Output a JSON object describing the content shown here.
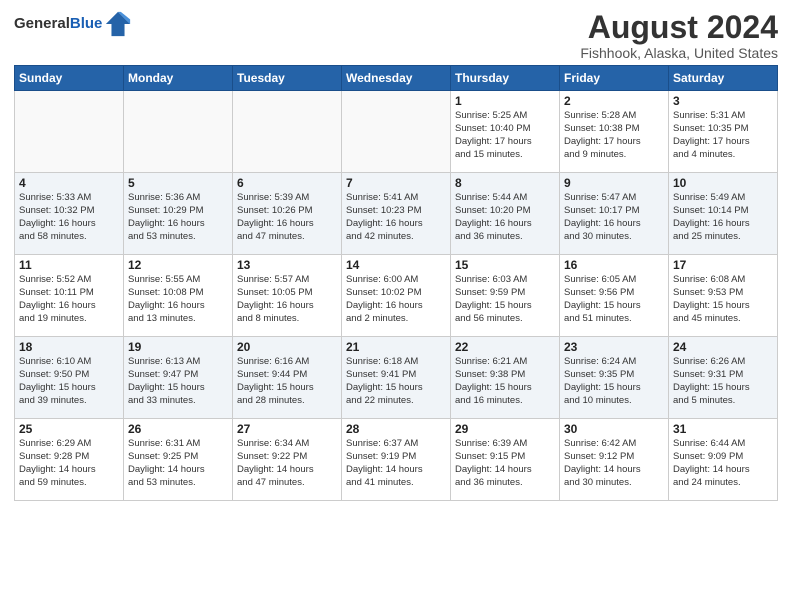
{
  "logo": {
    "line1": "General",
    "line2": "Blue"
  },
  "title": "August 2024",
  "subtitle": "Fishhook, Alaska, United States",
  "headers": [
    "Sunday",
    "Monday",
    "Tuesday",
    "Wednesday",
    "Thursday",
    "Friday",
    "Saturday"
  ],
  "weeks": [
    [
      {
        "day": "",
        "info": ""
      },
      {
        "day": "",
        "info": ""
      },
      {
        "day": "",
        "info": ""
      },
      {
        "day": "",
        "info": ""
      },
      {
        "day": "1",
        "info": "Sunrise: 5:25 AM\nSunset: 10:40 PM\nDaylight: 17 hours\nand 15 minutes."
      },
      {
        "day": "2",
        "info": "Sunrise: 5:28 AM\nSunset: 10:38 PM\nDaylight: 17 hours\nand 9 minutes."
      },
      {
        "day": "3",
        "info": "Sunrise: 5:31 AM\nSunset: 10:35 PM\nDaylight: 17 hours\nand 4 minutes."
      }
    ],
    [
      {
        "day": "4",
        "info": "Sunrise: 5:33 AM\nSunset: 10:32 PM\nDaylight: 16 hours\nand 58 minutes."
      },
      {
        "day": "5",
        "info": "Sunrise: 5:36 AM\nSunset: 10:29 PM\nDaylight: 16 hours\nand 53 minutes."
      },
      {
        "day": "6",
        "info": "Sunrise: 5:39 AM\nSunset: 10:26 PM\nDaylight: 16 hours\nand 47 minutes."
      },
      {
        "day": "7",
        "info": "Sunrise: 5:41 AM\nSunset: 10:23 PM\nDaylight: 16 hours\nand 42 minutes."
      },
      {
        "day": "8",
        "info": "Sunrise: 5:44 AM\nSunset: 10:20 PM\nDaylight: 16 hours\nand 36 minutes."
      },
      {
        "day": "9",
        "info": "Sunrise: 5:47 AM\nSunset: 10:17 PM\nDaylight: 16 hours\nand 30 minutes."
      },
      {
        "day": "10",
        "info": "Sunrise: 5:49 AM\nSunset: 10:14 PM\nDaylight: 16 hours\nand 25 minutes."
      }
    ],
    [
      {
        "day": "11",
        "info": "Sunrise: 5:52 AM\nSunset: 10:11 PM\nDaylight: 16 hours\nand 19 minutes."
      },
      {
        "day": "12",
        "info": "Sunrise: 5:55 AM\nSunset: 10:08 PM\nDaylight: 16 hours\nand 13 minutes."
      },
      {
        "day": "13",
        "info": "Sunrise: 5:57 AM\nSunset: 10:05 PM\nDaylight: 16 hours\nand 8 minutes."
      },
      {
        "day": "14",
        "info": "Sunrise: 6:00 AM\nSunset: 10:02 PM\nDaylight: 16 hours\nand 2 minutes."
      },
      {
        "day": "15",
        "info": "Sunrise: 6:03 AM\nSunset: 9:59 PM\nDaylight: 15 hours\nand 56 minutes."
      },
      {
        "day": "16",
        "info": "Sunrise: 6:05 AM\nSunset: 9:56 PM\nDaylight: 15 hours\nand 51 minutes."
      },
      {
        "day": "17",
        "info": "Sunrise: 6:08 AM\nSunset: 9:53 PM\nDaylight: 15 hours\nand 45 minutes."
      }
    ],
    [
      {
        "day": "18",
        "info": "Sunrise: 6:10 AM\nSunset: 9:50 PM\nDaylight: 15 hours\nand 39 minutes."
      },
      {
        "day": "19",
        "info": "Sunrise: 6:13 AM\nSunset: 9:47 PM\nDaylight: 15 hours\nand 33 minutes."
      },
      {
        "day": "20",
        "info": "Sunrise: 6:16 AM\nSunset: 9:44 PM\nDaylight: 15 hours\nand 28 minutes."
      },
      {
        "day": "21",
        "info": "Sunrise: 6:18 AM\nSunset: 9:41 PM\nDaylight: 15 hours\nand 22 minutes."
      },
      {
        "day": "22",
        "info": "Sunrise: 6:21 AM\nSunset: 9:38 PM\nDaylight: 15 hours\nand 16 minutes."
      },
      {
        "day": "23",
        "info": "Sunrise: 6:24 AM\nSunset: 9:35 PM\nDaylight: 15 hours\nand 10 minutes."
      },
      {
        "day": "24",
        "info": "Sunrise: 6:26 AM\nSunset: 9:31 PM\nDaylight: 15 hours\nand 5 minutes."
      }
    ],
    [
      {
        "day": "25",
        "info": "Sunrise: 6:29 AM\nSunset: 9:28 PM\nDaylight: 14 hours\nand 59 minutes."
      },
      {
        "day": "26",
        "info": "Sunrise: 6:31 AM\nSunset: 9:25 PM\nDaylight: 14 hours\nand 53 minutes."
      },
      {
        "day": "27",
        "info": "Sunrise: 6:34 AM\nSunset: 9:22 PM\nDaylight: 14 hours\nand 47 minutes."
      },
      {
        "day": "28",
        "info": "Sunrise: 6:37 AM\nSunset: 9:19 PM\nDaylight: 14 hours\nand 41 minutes."
      },
      {
        "day": "29",
        "info": "Sunrise: 6:39 AM\nSunset: 9:15 PM\nDaylight: 14 hours\nand 36 minutes."
      },
      {
        "day": "30",
        "info": "Sunrise: 6:42 AM\nSunset: 9:12 PM\nDaylight: 14 hours\nand 30 minutes."
      },
      {
        "day": "31",
        "info": "Sunrise: 6:44 AM\nSunset: 9:09 PM\nDaylight: 14 hours\nand 24 minutes."
      }
    ]
  ]
}
